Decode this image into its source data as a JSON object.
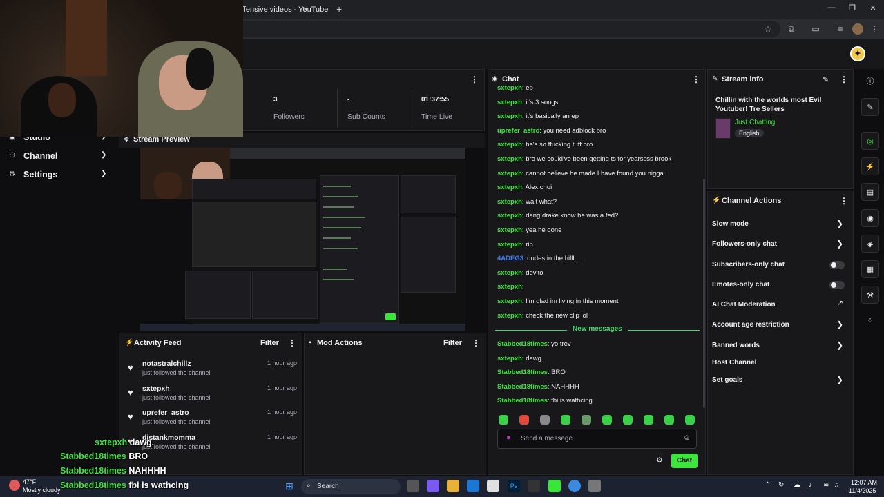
{
  "browser": {
    "tab_title": "ffensive videos - YouTube",
    "new_tab": "+",
    "close": "✕",
    "window_controls": [
      "—",
      "❐",
      "✕"
    ]
  },
  "sidebar": {
    "items": [
      {
        "label": "Studio",
        "icon": "studio-icon"
      },
      {
        "label": "Channel",
        "icon": "channel-icon"
      },
      {
        "label": "Settings",
        "icon": "gear-icon"
      }
    ]
  },
  "stats": {
    "items": [
      {
        "value": "3",
        "label": "Followers"
      },
      {
        "value": "-",
        "label": "Sub Counts"
      },
      {
        "value": "01:37:55",
        "label": "Time Live"
      }
    ]
  },
  "preview": {
    "title": "Stream Preview"
  },
  "activity": {
    "title": "Activity Feed",
    "filter": "Filter",
    "items": [
      {
        "user": "notastralchillz",
        "text": "just followed the channel",
        "time": "1 hour ago"
      },
      {
        "user": "sxtepxh",
        "text": "just followed the channel",
        "time": "1 hour ago"
      },
      {
        "user": "uprefer_astro",
        "text": "just followed the channel",
        "time": "1 hour ago"
      },
      {
        "user": "djstankmomma",
        "text": "just followed the channel",
        "time": "1 hour ago"
      }
    ]
  },
  "mod": {
    "title": "Mod Actions",
    "filter": "Filter"
  },
  "chat": {
    "title": "Chat",
    "messages": [
      {
        "user": "sxtepxh",
        "text": "ep",
        "color": "#3be63b"
      },
      {
        "user": "sxtepxh",
        "text": "it's 3 songs",
        "color": "#3be63b"
      },
      {
        "user": "sxtepxh",
        "text": "it's basically an ep",
        "color": "#3be63b"
      },
      {
        "user": "uprefer_astro",
        "text": "you need adblock bro",
        "color": "#3be63b"
      },
      {
        "user": "sxtepxh",
        "text": "he's so ffucking tuff bro",
        "color": "#3be63b"
      },
      {
        "user": "sxtepxh",
        "text": "bro we could've been getting ts for yearssss brook",
        "color": "#3be63b"
      },
      {
        "user": "sxtepxh",
        "text": "cannot believe he made I have found you nigga",
        "color": "#3be63b"
      },
      {
        "user": "sxtepxh",
        "text": "Alex choi",
        "color": "#3be63b"
      },
      {
        "user": "sxtepxh",
        "text": "wait what?",
        "color": "#3be63b"
      },
      {
        "user": "sxtepxh",
        "text": "dang drake know he was a fed?",
        "color": "#3be63b"
      },
      {
        "user": "sxtepxh",
        "text": "yea he gone",
        "color": "#3be63b"
      },
      {
        "user": "sxtepxh",
        "text": "rip",
        "color": "#3be63b"
      },
      {
        "user": "4ADEG3",
        "text": "dudes in the hilll....",
        "color": "#3a7cff"
      },
      {
        "user": "sxtepxh",
        "text": "devito",
        "color": "#3be63b"
      },
      {
        "user": "sxtepxh",
        "text": "",
        "color": "#3be63b"
      },
      {
        "user": "sxtepxh",
        "text": "I'm glad im living in this moment",
        "color": "#3be63b"
      },
      {
        "user": "sxtepxh",
        "text": "check the new clip lol",
        "color": "#3be63b"
      }
    ],
    "new_messages_label": "New messages",
    "new_messages": [
      {
        "user": "Stabbed18times",
        "text": "yo trev",
        "color": "#3be63b"
      },
      {
        "user": "sxtepxh",
        "text": "dawg.",
        "color": "#3be63b"
      },
      {
        "user": "Stabbed18times",
        "text": "BRO",
        "color": "#3be63b"
      },
      {
        "user": "Stabbed18times",
        "text": "NAHHHH",
        "color": "#3be63b"
      },
      {
        "user": "Stabbed18times",
        "text": "fbi is wathcing",
        "color": "#3be63b"
      }
    ],
    "input_placeholder": "Send a message",
    "send_label": "Chat"
  },
  "stream_info": {
    "title": "Stream info",
    "stream_title": "Chillin with the worlds most Evil Youtuber! Tre Sellers",
    "category": "Just Chatting",
    "tag": "English"
  },
  "channel_actions": {
    "title": "Channel Actions",
    "items": [
      {
        "label": "Slow mode",
        "control": "chevron"
      },
      {
        "label": "Followers-only chat",
        "control": "chevron"
      },
      {
        "label": "Subscribers-only chat",
        "control": "toggle"
      },
      {
        "label": "Emotes-only chat",
        "control": "toggle"
      },
      {
        "label": "AI Chat Moderation",
        "control": "external"
      },
      {
        "label": "Account age restriction",
        "control": "chevron"
      },
      {
        "label": "Banned words",
        "control": "chevron"
      },
      {
        "label": "Host Channel",
        "control": "none"
      },
      {
        "label": "Set goals",
        "control": "chevron"
      }
    ]
  },
  "captions": [
    {
      "user": "sxtepxh",
      "text": "dawg."
    },
    {
      "user": "Stabbed18times",
      "text": "BRO"
    },
    {
      "user": "Stabbed18times",
      "text": "NAHHHH"
    },
    {
      "user": "Stabbed18times",
      "text": "fbi is wathcing"
    }
  ],
  "taskbar": {
    "temp": "47°F",
    "weather": "Mostly cloudy",
    "search": "Search",
    "time": "12:07 AM",
    "date": "11/4/2025"
  },
  "colors": {
    "accent": "#3be63b",
    "background": "#0e0e10",
    "panel": "#18181b"
  }
}
